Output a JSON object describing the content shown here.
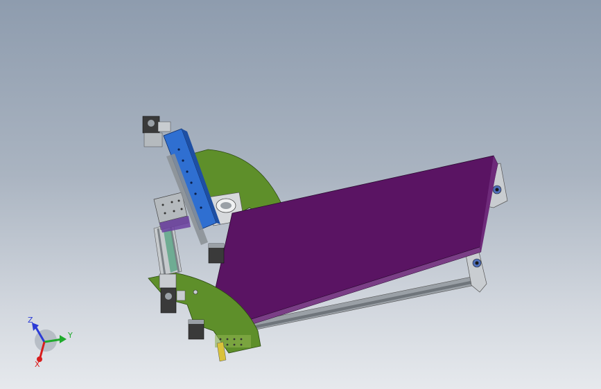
{
  "viewport": {
    "background_top": "#8e9cae",
    "background_bottom": "#e6e9ed"
  },
  "model": {
    "bed_color": "#5a1463",
    "side_plate_color": "#5e8f2a",
    "gantry_color": "#2f6fd1",
    "rail_color": "#8a8f94",
    "motor_color": "#3a3a3a",
    "bracket_color": "#c8ccd0"
  },
  "triad": {
    "z_label": "Z",
    "y_label": "Y",
    "x_label": "X",
    "z_color": "#2b3bd6",
    "y_color": "#1faa2c",
    "x_color": "#d81d1d"
  }
}
